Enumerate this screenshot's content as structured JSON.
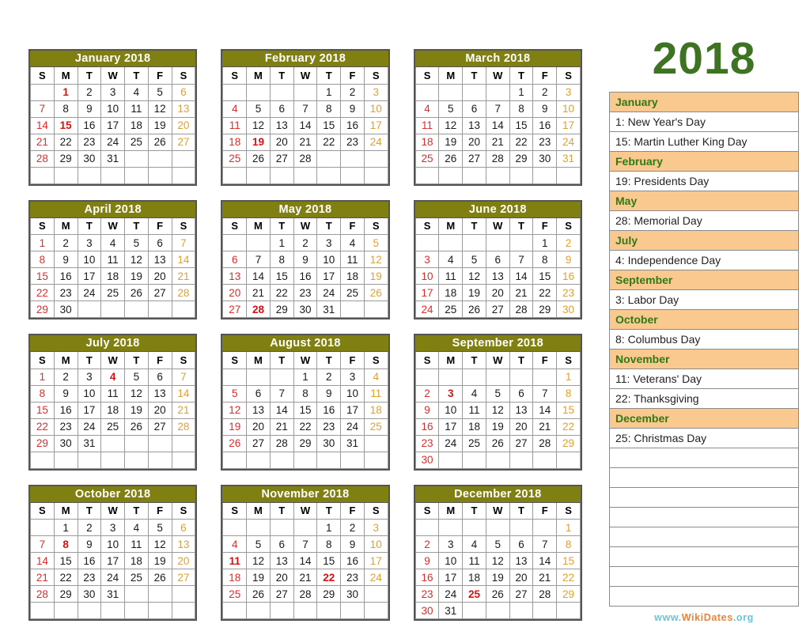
{
  "year": "2018",
  "watermark": {
    "www": "www.",
    "name": "WikiDates",
    "tld": ".org"
  },
  "weekday_headers": [
    "S",
    "M",
    "T",
    "W",
    "T",
    "F",
    "S"
  ],
  "months": [
    {
      "title": "January 2018",
      "weeks": [
        [
          "",
          "1",
          "2",
          "3",
          "4",
          "5",
          "6"
        ],
        [
          "7",
          "8",
          "9",
          "10",
          "11",
          "12",
          "13"
        ],
        [
          "14",
          "15",
          "16",
          "17",
          "18",
          "19",
          "20"
        ],
        [
          "21",
          "22",
          "23",
          "24",
          "25",
          "26",
          "27"
        ],
        [
          "28",
          "29",
          "30",
          "31",
          "",
          "",
          ""
        ],
        [
          "",
          "",
          "",
          "",
          "",
          "",
          ""
        ]
      ],
      "holidays": [
        "1",
        "15"
      ]
    },
    {
      "title": "February 2018",
      "weeks": [
        [
          "",
          "",
          "",
          "",
          "1",
          "2",
          "3"
        ],
        [
          "4",
          "5",
          "6",
          "7",
          "8",
          "9",
          "10"
        ],
        [
          "11",
          "12",
          "13",
          "14",
          "15",
          "16",
          "17"
        ],
        [
          "18",
          "19",
          "20",
          "21",
          "22",
          "23",
          "24"
        ],
        [
          "25",
          "26",
          "27",
          "28",
          "",
          "",
          ""
        ],
        [
          "",
          "",
          "",
          "",
          "",
          "",
          ""
        ]
      ],
      "holidays": [
        "19"
      ]
    },
    {
      "title": "March 2018",
      "weeks": [
        [
          "",
          "",
          "",
          "",
          "1",
          "2",
          "3"
        ],
        [
          "4",
          "5",
          "6",
          "7",
          "8",
          "9",
          "10"
        ],
        [
          "11",
          "12",
          "13",
          "14",
          "15",
          "16",
          "17"
        ],
        [
          "18",
          "19",
          "20",
          "21",
          "22",
          "23",
          "24"
        ],
        [
          "25",
          "26",
          "27",
          "28",
          "29",
          "30",
          "31"
        ],
        [
          "",
          "",
          "",
          "",
          "",
          "",
          ""
        ]
      ],
      "holidays": []
    },
    {
      "title": "April 2018",
      "weeks": [
        [
          "1",
          "2",
          "3",
          "4",
          "5",
          "6",
          "7"
        ],
        [
          "8",
          "9",
          "10",
          "11",
          "12",
          "13",
          "14"
        ],
        [
          "15",
          "16",
          "17",
          "18",
          "19",
          "20",
          "21"
        ],
        [
          "22",
          "23",
          "24",
          "25",
          "26",
          "27",
          "28"
        ],
        [
          "29",
          "30",
          "",
          "",
          "",
          "",
          ""
        ]
      ],
      "holidays": []
    },
    {
      "title": "May 2018",
      "weeks": [
        [
          "",
          "",
          "1",
          "2",
          "3",
          "4",
          "5"
        ],
        [
          "6",
          "7",
          "8",
          "9",
          "10",
          "11",
          "12"
        ],
        [
          "13",
          "14",
          "15",
          "16",
          "17",
          "18",
          "19"
        ],
        [
          "20",
          "21",
          "22",
          "23",
          "24",
          "25",
          "26"
        ],
        [
          "27",
          "28",
          "29",
          "30",
          "31",
          "",
          ""
        ]
      ],
      "holidays": [
        "28"
      ]
    },
    {
      "title": "June 2018",
      "weeks": [
        [
          "",
          "",
          "",
          "",
          "",
          "1",
          "2"
        ],
        [
          "3",
          "4",
          "5",
          "6",
          "7",
          "8",
          "9"
        ],
        [
          "10",
          "11",
          "12",
          "13",
          "14",
          "15",
          "16"
        ],
        [
          "17",
          "18",
          "19",
          "20",
          "21",
          "22",
          "23"
        ],
        [
          "24",
          "25",
          "26",
          "27",
          "28",
          "29",
          "30"
        ]
      ],
      "holidays": []
    },
    {
      "title": "July 2018",
      "weeks": [
        [
          "1",
          "2",
          "3",
          "4",
          "5",
          "6",
          "7"
        ],
        [
          "8",
          "9",
          "10",
          "11",
          "12",
          "13",
          "14"
        ],
        [
          "15",
          "16",
          "17",
          "18",
          "19",
          "20",
          "21"
        ],
        [
          "22",
          "23",
          "24",
          "25",
          "26",
          "27",
          "28"
        ],
        [
          "29",
          "30",
          "31",
          "",
          "",
          "",
          ""
        ],
        [
          "",
          "",
          "",
          "",
          "",
          "",
          ""
        ]
      ],
      "holidays": [
        "4"
      ]
    },
    {
      "title": "August 2018",
      "weeks": [
        [
          "",
          "",
          "",
          "1",
          "2",
          "3",
          "4"
        ],
        [
          "5",
          "6",
          "7",
          "8",
          "9",
          "10",
          "11"
        ],
        [
          "12",
          "13",
          "14",
          "15",
          "16",
          "17",
          "18"
        ],
        [
          "19",
          "20",
          "21",
          "22",
          "23",
          "24",
          "25"
        ],
        [
          "26",
          "27",
          "28",
          "29",
          "30",
          "31",
          ""
        ],
        [
          "",
          "",
          "",
          "",
          "",
          "",
          ""
        ]
      ],
      "holidays": []
    },
    {
      "title": "September 2018",
      "weeks": [
        [
          "",
          "",
          "",
          "",
          "",
          "",
          "1"
        ],
        [
          "2",
          "3",
          "4",
          "5",
          "6",
          "7",
          "8"
        ],
        [
          "9",
          "10",
          "11",
          "12",
          "13",
          "14",
          "15"
        ],
        [
          "16",
          "17",
          "18",
          "19",
          "20",
          "21",
          "22"
        ],
        [
          "23",
          "24",
          "25",
          "26",
          "27",
          "28",
          "29"
        ],
        [
          "30",
          "",
          "",
          "",
          "",
          "",
          ""
        ]
      ],
      "holidays": [
        "3"
      ]
    },
    {
      "title": "October 2018",
      "weeks": [
        [
          "",
          "1",
          "2",
          "3",
          "4",
          "5",
          "6"
        ],
        [
          "7",
          "8",
          "9",
          "10",
          "11",
          "12",
          "13"
        ],
        [
          "14",
          "15",
          "16",
          "17",
          "18",
          "19",
          "20"
        ],
        [
          "21",
          "22",
          "23",
          "24",
          "25",
          "26",
          "27"
        ],
        [
          "28",
          "29",
          "30",
          "31",
          "",
          "",
          ""
        ],
        [
          "",
          "",
          "",
          "",
          "",
          "",
          ""
        ]
      ],
      "holidays": [
        "8"
      ]
    },
    {
      "title": "November 2018",
      "weeks": [
        [
          "",
          "",
          "",
          "",
          "1",
          "2",
          "3"
        ],
        [
          "4",
          "5",
          "6",
          "7",
          "8",
          "9",
          "10"
        ],
        [
          "11",
          "12",
          "13",
          "14",
          "15",
          "16",
          "17"
        ],
        [
          "18",
          "19",
          "20",
          "21",
          "22",
          "23",
          "24"
        ],
        [
          "25",
          "26",
          "27",
          "28",
          "29",
          "30",
          ""
        ],
        [
          "",
          "",
          "",
          "",
          "",
          "",
          ""
        ]
      ],
      "holidays": [
        "11",
        "22"
      ]
    },
    {
      "title": "December 2018",
      "weeks": [
        [
          "",
          "",
          "",
          "",
          "",
          "",
          "1"
        ],
        [
          "2",
          "3",
          "4",
          "5",
          "6",
          "7",
          "8"
        ],
        [
          "9",
          "10",
          "11",
          "12",
          "13",
          "14",
          "15"
        ],
        [
          "16",
          "17",
          "18",
          "19",
          "20",
          "21",
          "22"
        ],
        [
          "23",
          "24",
          "25",
          "26",
          "27",
          "28",
          "29"
        ],
        [
          "30",
          "31",
          "",
          "",
          "",
          "",
          ""
        ]
      ],
      "holidays": [
        "25"
      ]
    }
  ],
  "holiday_list": [
    {
      "type": "month",
      "text": "January"
    },
    {
      "type": "entry",
      "text": "1: New Year's Day"
    },
    {
      "type": "entry",
      "text": "15: Martin Luther King Day"
    },
    {
      "type": "month",
      "text": "February"
    },
    {
      "type": "entry",
      "text": "19: Presidents Day"
    },
    {
      "type": "month",
      "text": "May"
    },
    {
      "type": "entry",
      "text": "28: Memorial Day"
    },
    {
      "type": "month",
      "text": "July"
    },
    {
      "type": "entry",
      "text": "4: Independence Day"
    },
    {
      "type": "month",
      "text": "September"
    },
    {
      "type": "entry",
      "text": "3: Labor Day"
    },
    {
      "type": "month",
      "text": "October"
    },
    {
      "type": "entry",
      "text": "8: Columbus Day"
    },
    {
      "type": "month",
      "text": "November"
    },
    {
      "type": "entry",
      "text": "11: Veterans' Day"
    },
    {
      "type": "entry",
      "text": "22: Thanksgiving"
    },
    {
      "type": "month",
      "text": "December"
    },
    {
      "type": "entry",
      "text": "25: Christmas Day"
    },
    {
      "type": "blank",
      "text": ""
    },
    {
      "type": "blank",
      "text": ""
    },
    {
      "type": "blank",
      "text": ""
    },
    {
      "type": "blank",
      "text": ""
    },
    {
      "type": "blank",
      "text": ""
    },
    {
      "type": "blank",
      "text": ""
    },
    {
      "type": "blank",
      "text": ""
    },
    {
      "type": "blank",
      "text": ""
    }
  ],
  "colors": {
    "month_header_bg": "#808012",
    "sunday": "#e02b2b",
    "saturday": "#e0a030",
    "holiday": "#d81010",
    "year_title": "#3d7322",
    "sidebar_month_bg": "#fac990",
    "sidebar_month_text": "#2f7a16"
  }
}
